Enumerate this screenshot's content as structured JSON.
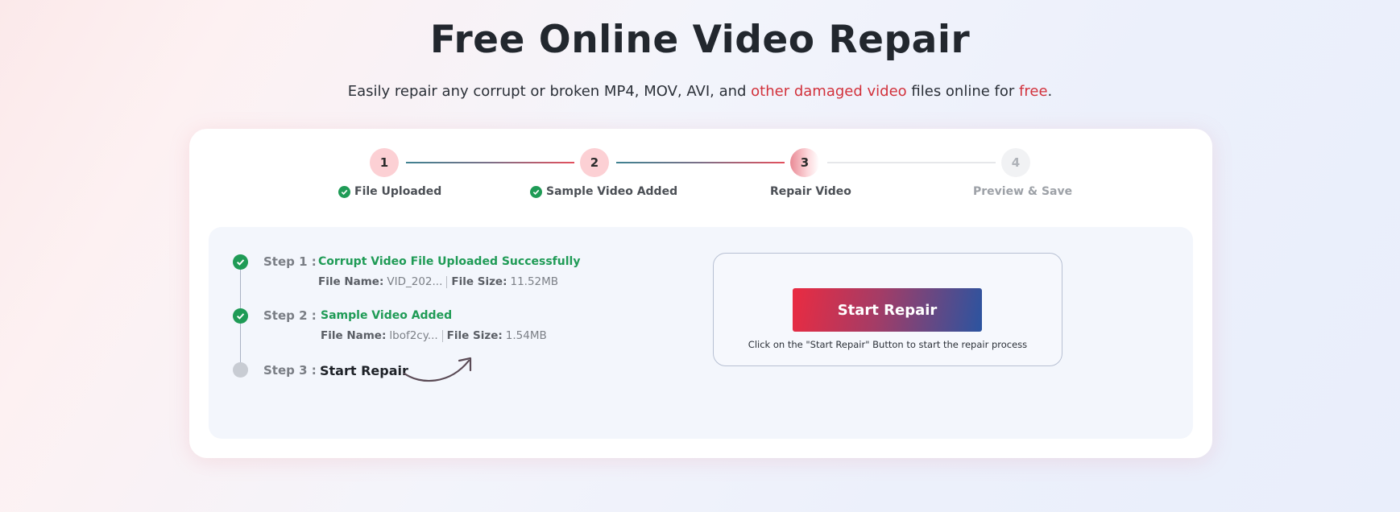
{
  "header": {
    "title": "Free Online Video Repair",
    "subtitle_part1": "Easily repair any corrupt or broken MP4, MOV, AVI, and ",
    "subtitle_link1": "other damaged video",
    "subtitle_part2": " files online for ",
    "subtitle_link2": "free",
    "subtitle_part3": "."
  },
  "stepper": {
    "steps": [
      {
        "number": "1",
        "label": "File Uploaded",
        "status": "done"
      },
      {
        "number": "2",
        "label": "Sample Video Added",
        "status": "done"
      },
      {
        "number": "3",
        "label": "Repair Video",
        "status": "active"
      },
      {
        "number": "4",
        "label": "Preview & Save",
        "status": "pending"
      }
    ]
  },
  "progress": {
    "step1": {
      "label": "Step 1 :",
      "status_text": "Corrupt Video File Uploaded Successfully",
      "file_name_label": "File Name:",
      "file_name": "VID_202...",
      "file_size_label": "File Size:",
      "file_size": "11.52MB"
    },
    "step2": {
      "label": "Step 2 :",
      "status_text": "Sample Video Added",
      "file_name_label": "File Name:",
      "file_name": "lbof2cy...",
      "file_size_label": "File Size:",
      "file_size": "1.54MB"
    },
    "step3": {
      "label": "Step 3 :",
      "status_text": "Start Repair"
    }
  },
  "repair": {
    "button_label": "Start Repair",
    "hint": "Click on the \"Start Repair\" Button to start the repair process"
  },
  "colors": {
    "accent_red": "#d2313b",
    "success_green": "#1f9b56",
    "button_gradient_start": "#ea2b41",
    "button_gradient_end": "#2b54a0"
  }
}
